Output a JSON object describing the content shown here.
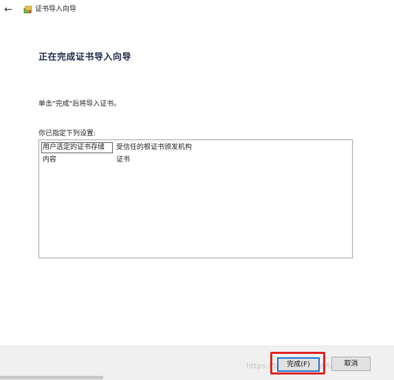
{
  "window": {
    "back_glyph": "←",
    "title": "证书导入向导",
    "icon": "certificate-wizard-icon"
  },
  "page": {
    "heading": "正在完成证书导入向导",
    "instruction": "单击\"完成\"后将导入证书。",
    "settings_label": "你已指定下列设置:"
  },
  "settings": [
    {
      "key": "用户选定的证书存储",
      "value": "受信任的根证书颁发机构"
    },
    {
      "key": "内容",
      "value": "证书"
    }
  ],
  "buttons": {
    "finish": "完成(F)",
    "cancel": "取消"
  },
  "watermark": "https://blog.csdn.net/tomdayIL",
  "colors": {
    "heading": "#1c2a4a",
    "highlight": "#e02020",
    "default_button_border": "#1a6fd1"
  }
}
